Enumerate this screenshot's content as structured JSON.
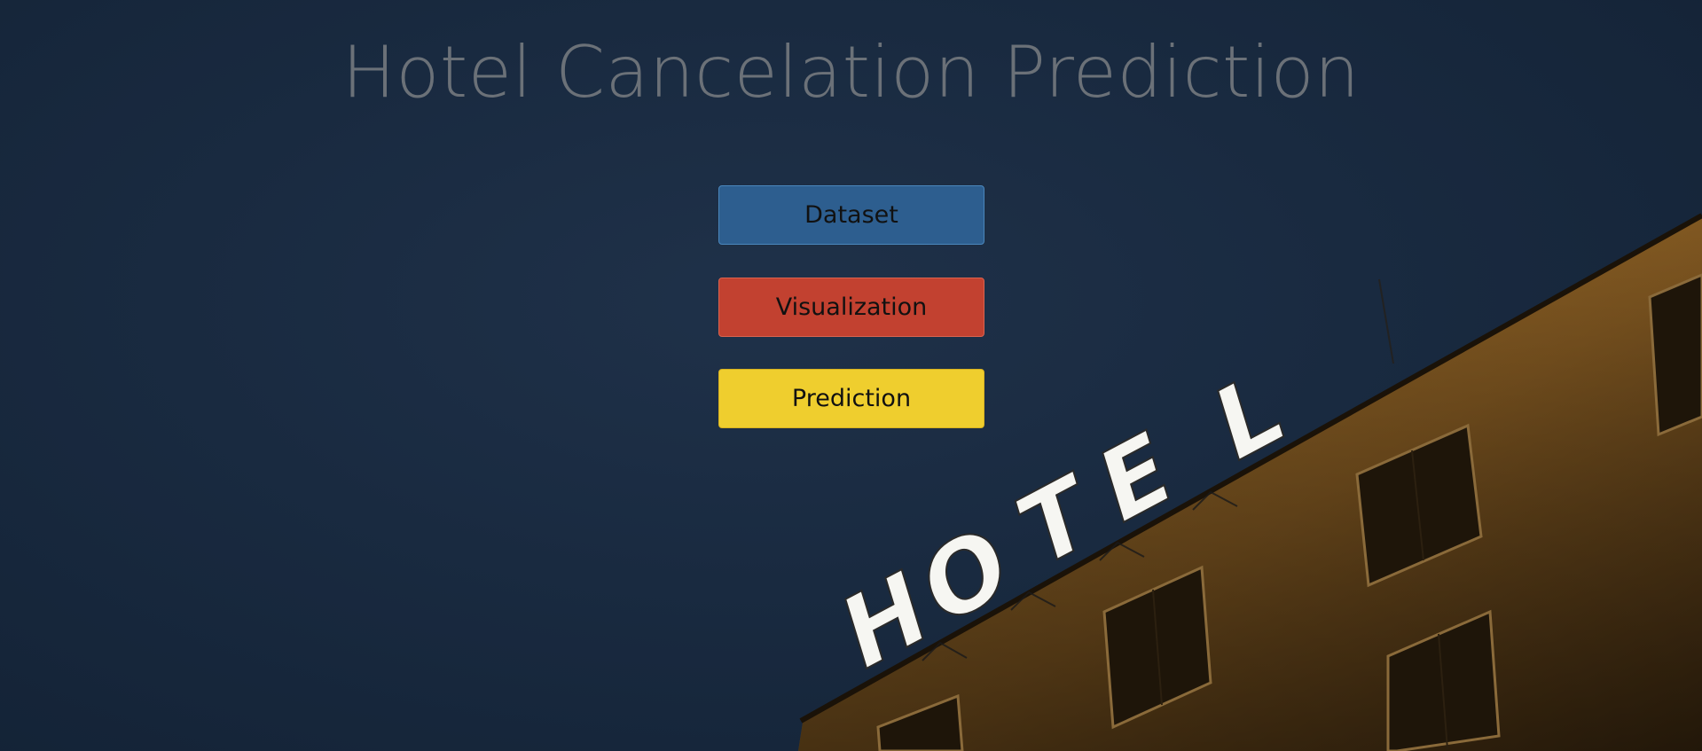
{
  "page": {
    "title": "Hotel Cancelation Prediction"
  },
  "buttons": {
    "dataset": "Dataset",
    "visualization": "Visualization",
    "prediction": "Prediction"
  },
  "background": {
    "sign_text": "HOTEL",
    "sky_color": "#1b2c42",
    "building_color": "#c08a3a"
  },
  "colors": {
    "dataset": "#2d5e8f",
    "visualization": "#c24130",
    "prediction": "#efce2e",
    "title": "#6b7178"
  }
}
